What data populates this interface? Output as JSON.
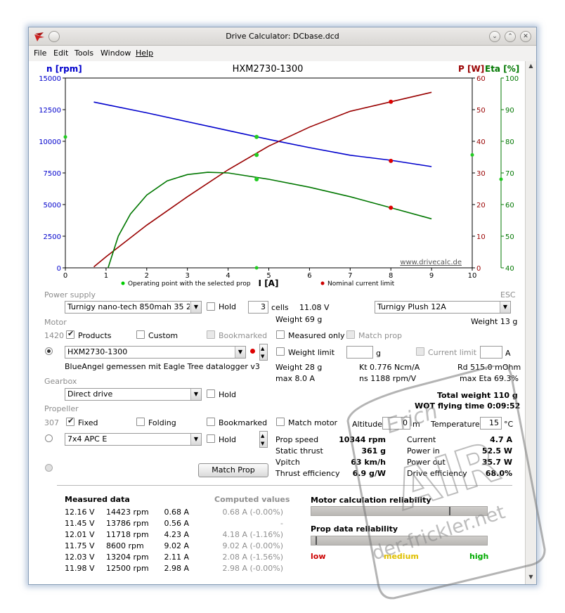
{
  "window": {
    "title": "Drive Calculator: DCbase.dcd",
    "menu": [
      "File",
      "Edit",
      "Tools",
      "Window",
      "Help"
    ]
  },
  "chart": {
    "title": "HXM2730-1300",
    "left_axis_label": "n [rpm]",
    "right_axis_label_p": "P [W]",
    "right_axis_label_eta": "Eta [%]",
    "x_axis_label": "I [A]",
    "watermark_url": "www.drivecalc.de",
    "legend_operating": "Operating point with the selected prop",
    "legend_nominal": "Nominal current limit",
    "colors": {
      "rpm": "#0000cc",
      "power": "#990000",
      "eta": "#007700"
    },
    "x_ticks": [
      "0",
      "1",
      "2",
      "3",
      "4",
      "5",
      "6",
      "7",
      "8",
      "9",
      "10"
    ],
    "rpm_ticks": [
      "0",
      "2500",
      "5000",
      "7500",
      "10000",
      "12500",
      "15000"
    ],
    "p_ticks": [
      "0",
      "10",
      "20",
      "30",
      "40",
      "50",
      "60"
    ],
    "eta_ticks": [
      "40",
      "50",
      "60",
      "70",
      "80",
      "90",
      "100"
    ]
  },
  "chart_data": {
    "type": "line",
    "title": "HXM2730-1300",
    "xlabel": "I [A]",
    "xlim": [
      0,
      10
    ],
    "axes": {
      "rpm": {
        "label": "n [rpm]",
        "range": [
          0,
          15000
        ]
      },
      "power": {
        "label": "P [W]",
        "range": [
          0,
          60
        ]
      },
      "eta": {
        "label": "Eta [%]",
        "range": [
          40,
          100
        ]
      }
    },
    "series": [
      {
        "name": "n [rpm]",
        "axis": "rpm",
        "color": "#0000cc",
        "x": [
          0.7,
          2,
          3,
          4,
          5,
          6,
          7,
          8,
          9
        ],
        "y": [
          13100,
          12250,
          11550,
          10850,
          10150,
          9500,
          8900,
          8500,
          8000
        ]
      },
      {
        "name": "P [W]",
        "axis": "power",
        "color": "#990000",
        "x": [
          0.7,
          1,
          2,
          3,
          4,
          5,
          6,
          7,
          8,
          9
        ],
        "y": [
          0.3,
          3.5,
          13.5,
          22.5,
          31,
          38.5,
          44.5,
          49.5,
          52.5,
          55.5
        ]
      },
      {
        "name": "Eta [%]",
        "axis": "eta",
        "color": "#007700",
        "x": [
          1.05,
          1.3,
          1.6,
          2,
          2.5,
          3,
          3.5,
          4,
          5,
          6,
          7,
          8,
          9
        ],
        "y": [
          40,
          50,
          57,
          63,
          67.5,
          69.5,
          70.2,
          70,
          68,
          65.5,
          62.5,
          59,
          55.5
        ]
      }
    ],
    "operating_point": {
      "x": 4.7,
      "rpm": 10344,
      "power": 35.7,
      "eta": 68.0
    },
    "nominal_current": {
      "x": 8,
      "rpm": 8450,
      "power": 52.5,
      "eta": 59
    },
    "axis_marks": {
      "rpm_left": 10344,
      "power_right": 35.7,
      "eta_right": 68.0
    }
  },
  "power_supply": {
    "section": "Power supply",
    "battery": "Turnigy nano-tech 850mah 35 25~4",
    "hold_label": "Hold",
    "cells": "3",
    "cells_label": "cells",
    "voltage": "11.08 V",
    "weight": "Weight 69 g"
  },
  "esc": {
    "section": "ESC",
    "value": "Turnigy Plush 12A",
    "weight": "Weight 13 g"
  },
  "motor": {
    "section": "Motor",
    "count": "1420",
    "products_label": "Products",
    "custom_label": "Custom",
    "bookmarked_label": "Bookmarked",
    "measured_only_label": "Measured only",
    "match_prop_label": "Match prop",
    "value": "HXM2730-1300",
    "weight_limit_label": "Weight limit",
    "weight_limit_unit": "g",
    "current_limit_label": "Current limit",
    "current_limit_unit": "A",
    "note": "BlueAngel gemessen mit Eagle Tree datalogger v3",
    "weight": "Weight 28 g",
    "kt": "Kt 0.776 Ncm/A",
    "rd": "Rd 515.0 mOhm",
    "max_current": "max 8.0 A",
    "ns": "ns 1188 rpm/V",
    "max_eta": "max Eta 69.3%"
  },
  "gearbox": {
    "section": "Gearbox",
    "value": "Direct drive",
    "hold_label": "Hold",
    "total_weight": "Total weight 110 g",
    "flying_time": "WOT flying time 0:09:52"
  },
  "propeller": {
    "section": "Propeller",
    "count": "307",
    "fixed_label": "Fixed",
    "folding_label": "Folding",
    "bookmarked_label": "Bookmarked",
    "match_motor_label": "Match motor",
    "altitude_label": "Altitude",
    "altitude_value": "0",
    "altitude_unit": "m",
    "temperature_label": "Temperature",
    "temperature_value": "15",
    "temperature_unit": "°C",
    "value": "7x4 APC E",
    "hold_label": "Hold",
    "match_prop_button": "Match Prop"
  },
  "results": {
    "prop_speed_label": "Prop speed",
    "prop_speed": "10344 rpm",
    "static_thrust_label": "Static thrust",
    "static_thrust": "361 g",
    "vpitch_label": "Vpitch",
    "vpitch": "63 km/h",
    "thrust_eff_label": "Thrust efficiency",
    "thrust_eff": "6.9 g/W",
    "current_label": "Current",
    "current": "4.7 A",
    "power_in_label": "Power in",
    "power_in": "52.5 W",
    "power_out_label": "Power out",
    "power_out": "35.7 W",
    "drive_eff_label": "Drive efficiency",
    "drive_eff": "68.0%"
  },
  "measured": {
    "title": "Measured data",
    "computed_title": "Computed values",
    "rows": [
      {
        "v": "12.16 V",
        "rpm": "14423 rpm",
        "a": "0.68 A",
        "c": "0.68 A (-0.00%)"
      },
      {
        "v": "11.45 V",
        "rpm": "13786 rpm",
        "a": "0.56 A",
        "c": "-"
      },
      {
        "v": "12.01 V",
        "rpm": "11718 rpm",
        "a": "4.23 A",
        "c": "4.18 A (-1.16%)"
      },
      {
        "v": "11.75 V",
        "rpm": "8600 rpm",
        "a": "9.02 A",
        "c": "9.02 A (-0.00%)"
      },
      {
        "v": "12.03 V",
        "rpm": "13204 rpm",
        "a": "2.11 A",
        "c": "2.08 A (-1.56%)"
      },
      {
        "v": "11.98 V",
        "rpm": "12500 rpm",
        "a": "2.98 A",
        "c": "2.98 A (-0.00%)"
      }
    ]
  },
  "reliability": {
    "motor_title": "Motor calculation reliability",
    "motor_level": 0.8,
    "prop_title": "Prop data reliability",
    "prop_level": 0.0,
    "low": "low",
    "medium": "medium",
    "high": "high",
    "colors": {
      "low": "#cc0000",
      "medium": "#e0c000",
      "high": "#00aa00"
    }
  },
  "stamp": {
    "line1": "Erich",
    "line2": "AIR",
    "line3": "der-frickler.net"
  }
}
